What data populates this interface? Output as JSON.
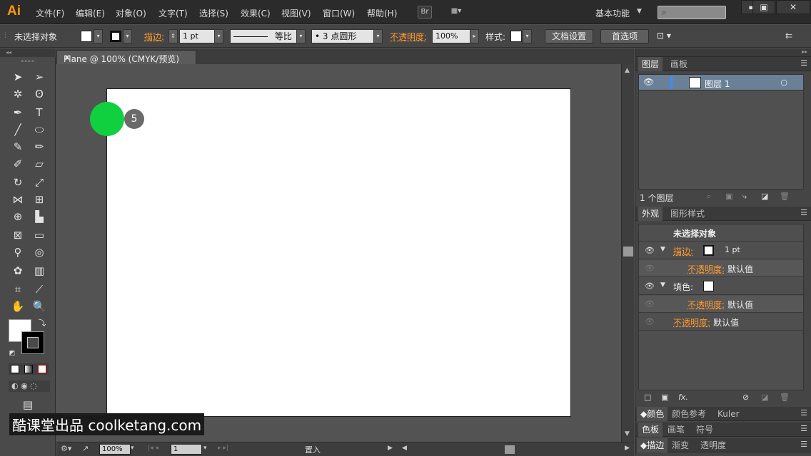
{
  "app": {
    "logo": "Ai",
    "menu": [
      "文件(F)",
      "编辑(E)",
      "对象(O)",
      "文字(T)",
      "选择(S)",
      "效果(C)",
      "视图(V)",
      "窗口(W)",
      "帮助(H)"
    ],
    "bridge_label": "Br",
    "workspace": "基本功能",
    "search_placeholder": "",
    "accent_color": "#ff9a00"
  },
  "controlbar": {
    "selection": "未选择对象",
    "stroke_label": "描边:",
    "stroke_weight": "1 pt",
    "line_profile": "等比",
    "brush": "• 3 点圆形",
    "opacity_label": "不透明度:",
    "opacity_value": "100%",
    "style_label": "样式:",
    "doc_setup_button": "文档设置",
    "prefs_button": "首选项"
  },
  "document": {
    "tab_title": "Plane @ 100% (CMYK/预览)",
    "step_badge": "5",
    "step_color": "#10d040"
  },
  "statusbar": {
    "zoom": "100%",
    "artboard": "1",
    "status": "置入"
  },
  "layers_panel": {
    "tabs": [
      "图层",
      "画板"
    ],
    "layers": [
      {
        "name": "图层 1"
      }
    ],
    "count": "1 个图层"
  },
  "appearance_panel": {
    "tabs": [
      "外观",
      "图形样式"
    ],
    "header": "未选择对象",
    "stroke_label": "描边:",
    "stroke_value": "1 pt",
    "opacity_label": "不透明度:",
    "opacity_value": "默认值",
    "fill_label": "填色:",
    "fx_label": "fx."
  },
  "bottom_panels": {
    "row1": [
      "颜色",
      "颜色参考",
      "Kuler"
    ],
    "row2": [
      "色板",
      "画笔",
      "符号"
    ],
    "row3": [
      "描边",
      "渐变",
      "透明度"
    ]
  },
  "watermark": "酷课堂出品 coolketang.com"
}
